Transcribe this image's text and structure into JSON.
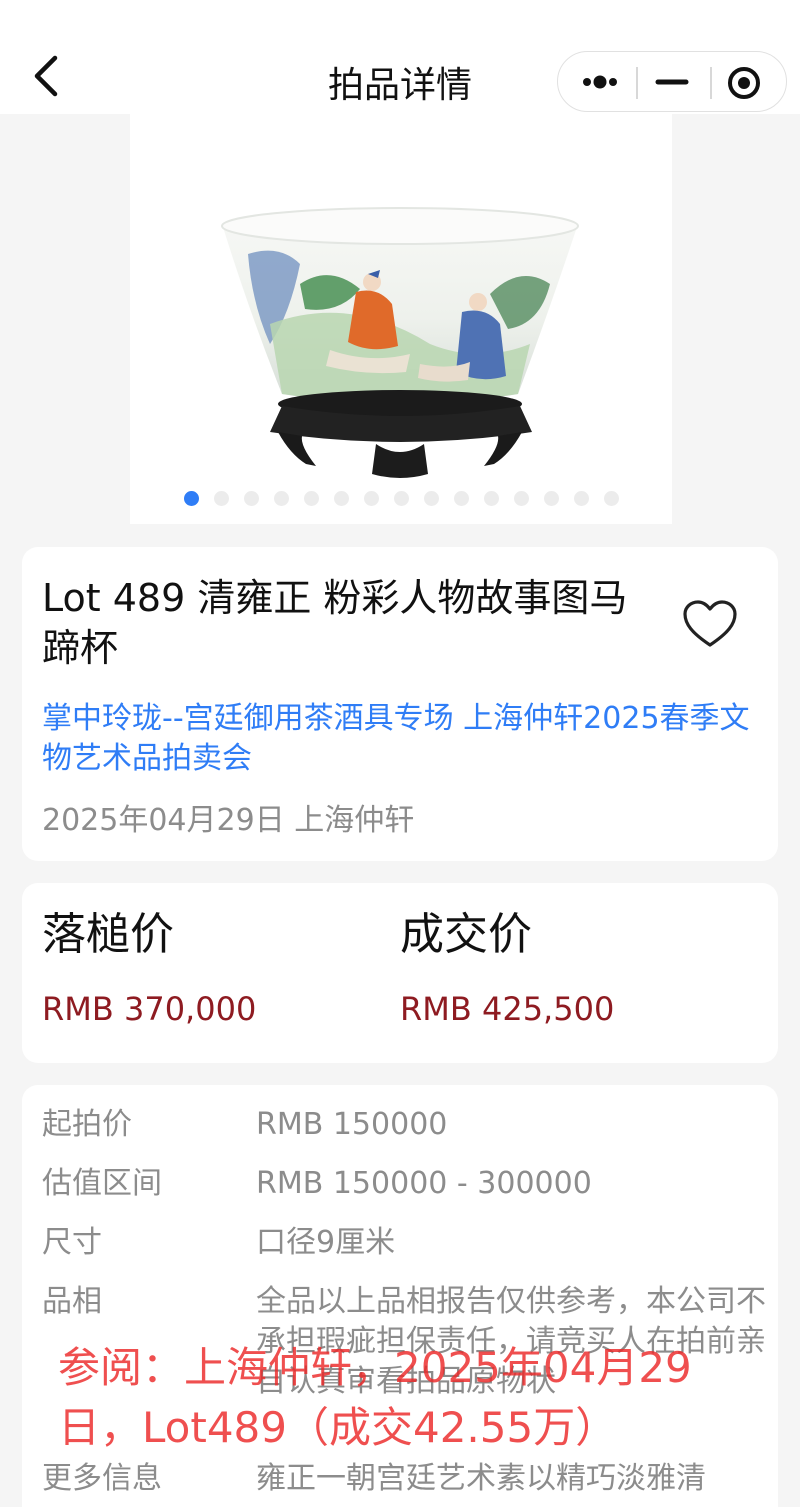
{
  "navbar": {
    "title": "拍品详情",
    "back_icon": "chevron-left-icon",
    "capsule_icons": [
      "more-dots-icon",
      "minimize-icon",
      "close-target-icon"
    ]
  },
  "gallery": {
    "image": "porcelain-cup-on-stand",
    "dot_count": 15,
    "active_index": 0,
    "accent": "#2f7df6"
  },
  "lot": {
    "title": "Lot 489 清雍正 粉彩人物故事图马蹄杯",
    "session": "掌中玲珑--宫廷御用茶酒具专场 上海仲轩2025春季文物艺术品拍卖会",
    "date_house": "2025年04月29日 上海仲轩",
    "favorite_icon": "heart-outline-icon"
  },
  "prices": {
    "hammer_label": "落槌价",
    "hammer_value": "RMB 370,000",
    "final_label": "成交价",
    "final_value": "RMB 425,500",
    "value_color": "#8e1b21"
  },
  "details": [
    {
      "key": "起拍价",
      "value": "RMB 150000"
    },
    {
      "key": "估值区间",
      "value": "RMB 150000 - 300000"
    },
    {
      "key": "尺寸",
      "value": "口径9厘米"
    },
    {
      "key": "品相",
      "value": "全品以上品相报告仅供参考，本公司不承担瑕疵担保责任，请竞买人在拍前亲自认真审看拍品原物状"
    },
    {
      "key": "更多信息",
      "value": "雍正一朝宫廷艺术素以精巧淡雅清"
    }
  ],
  "overlay": {
    "text": "参阅：上海仲轩，2025年04月29日，Lot489（成交42.55万）",
    "color": "#eb2828"
  }
}
